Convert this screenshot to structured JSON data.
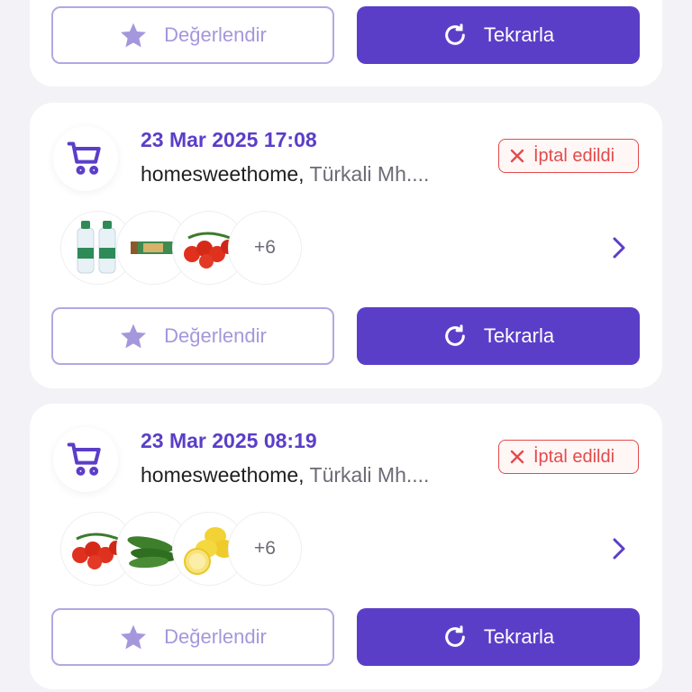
{
  "top_card": {
    "rate_label": "Değerlendir",
    "repeat_label": "Tekrarla"
  },
  "orders": [
    {
      "date": "23 Mar 2025 17:08",
      "store": "homesweethome,",
      "street": "Türkali Mh....",
      "status": "İptal edildi",
      "more_count": "+6",
      "products": [
        "water-bottles-image",
        "snack-bar-image",
        "cherry-tomatoes-image"
      ],
      "rate_label": "Değerlendir",
      "repeat_label": "Tekrarla"
    },
    {
      "date": "23 Mar 2025 08:19",
      "store": "homesweethome,",
      "street": "Türkali Mh....",
      "status": "İptal edildi",
      "more_count": "+6",
      "products": [
        "cherry-tomatoes-image",
        "cucumbers-image",
        "lemons-image"
      ],
      "rate_label": "Değerlendir",
      "repeat_label": "Tekrarla"
    }
  ],
  "colors": {
    "accent": "#5b3ec8",
    "accent_light": "#a597dc",
    "cancelled": "#e34b4b",
    "background": "#f3f2f6"
  }
}
